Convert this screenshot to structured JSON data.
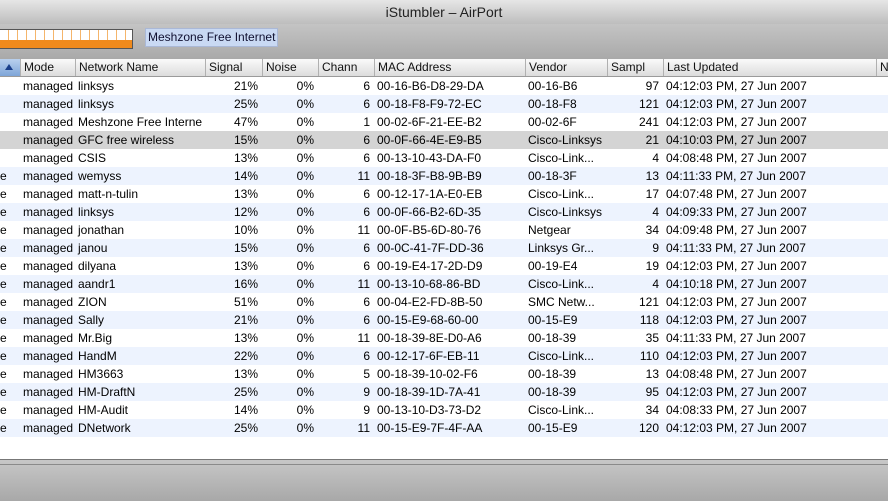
{
  "window": {
    "title": "iStumbler – AirPort"
  },
  "toolbar": {
    "network_label": "Meshzone Free Internet"
  },
  "table": {
    "columns": [
      "",
      "Mode",
      "Network Name",
      "Signal",
      "Noise",
      "Chann",
      "MAC Address",
      "Vendor",
      "Sampl",
      "Last Updated",
      "N"
    ],
    "rows": [
      {
        "lead": "",
        "mode": "managed",
        "name": "linksys",
        "signal": "21%",
        "noise": "0%",
        "channel": "6",
        "mac": "00-16-B6-D8-29-DA",
        "vendor": "00-16-B6",
        "samples": "97",
        "updated": "04:12:03 PM, 27 Jun 2007"
      },
      {
        "lead": "",
        "mode": "managed",
        "name": "linksys",
        "signal": "25%",
        "noise": "0%",
        "channel": "6",
        "mac": "00-18-F8-F9-72-EC",
        "vendor": "00-18-F8",
        "samples": "121",
        "updated": "04:12:03 PM, 27 Jun 2007"
      },
      {
        "lead": "",
        "mode": "managed",
        "name": "Meshzone Free Interne",
        "signal": "47%",
        "noise": "0%",
        "channel": "1",
        "mac": "00-02-6F-21-EE-B2",
        "vendor": "00-02-6F",
        "samples": "241",
        "updated": "04:12:03 PM, 27 Jun 2007"
      },
      {
        "lead": "",
        "mode": "managed",
        "name": "GFC free wireless",
        "signal": "15%",
        "noise": "0%",
        "channel": "6",
        "mac": "00-0F-66-4E-E9-B5",
        "vendor": "Cisco-Linksys",
        "samples": "21",
        "updated": "04:10:03 PM, 27 Jun 2007"
      },
      {
        "lead": "",
        "mode": "managed",
        "name": "CSIS",
        "signal": "13%",
        "noise": "0%",
        "channel": "6",
        "mac": "00-13-10-43-DA-F0",
        "vendor": "Cisco-Link...",
        "samples": "4",
        "updated": "04:08:48 PM, 27 Jun 2007"
      },
      {
        "lead": "e",
        "mode": "managed",
        "name": "wemyss",
        "signal": "14%",
        "noise": "0%",
        "channel": "11",
        "mac": "00-18-3F-B8-9B-B9",
        "vendor": "00-18-3F",
        "samples": "13",
        "updated": "04:11:33 PM, 27 Jun 2007"
      },
      {
        "lead": "e",
        "mode": "managed",
        "name": "matt-n-tulin",
        "signal": "13%",
        "noise": "0%",
        "channel": "6",
        "mac": "00-12-17-1A-E0-EB",
        "vendor": "Cisco-Link...",
        "samples": "17",
        "updated": "04:07:48 PM, 27 Jun 2007"
      },
      {
        "lead": "e",
        "mode": "managed",
        "name": "linksys",
        "signal": "12%",
        "noise": "0%",
        "channel": "6",
        "mac": "00-0F-66-B2-6D-35",
        "vendor": "Cisco-Linksys",
        "samples": "4",
        "updated": "04:09:33 PM, 27 Jun 2007"
      },
      {
        "lead": "e",
        "mode": "managed",
        "name": "jonathan",
        "signal": "10%",
        "noise": "0%",
        "channel": "11",
        "mac": "00-0F-B5-6D-80-76",
        "vendor": "Netgear",
        "samples": "34",
        "updated": "04:09:48 PM, 27 Jun 2007"
      },
      {
        "lead": "e",
        "mode": "managed",
        "name": "janou",
        "signal": "15%",
        "noise": "0%",
        "channel": "6",
        "mac": "00-0C-41-7F-DD-36",
        "vendor": "Linksys Gr...",
        "samples": "9",
        "updated": "04:11:33 PM, 27 Jun 2007"
      },
      {
        "lead": "e",
        "mode": "managed",
        "name": "dilyana",
        "signal": "13%",
        "noise": "0%",
        "channel": "6",
        "mac": "00-19-E4-17-2D-D9",
        "vendor": "00-19-E4",
        "samples": "19",
        "updated": "04:12:03 PM, 27 Jun 2007"
      },
      {
        "lead": "e",
        "mode": "managed",
        "name": "aandr1",
        "signal": "16%",
        "noise": "0%",
        "channel": "11",
        "mac": "00-13-10-68-86-BD",
        "vendor": "Cisco-Link...",
        "samples": "4",
        "updated": "04:10:18 PM, 27 Jun 2007"
      },
      {
        "lead": "e",
        "mode": "managed",
        "name": "ZION",
        "signal": "51%",
        "noise": "0%",
        "channel": "6",
        "mac": "00-04-E2-FD-8B-50",
        "vendor": "SMC Netw...",
        "samples": "121",
        "updated": "04:12:03 PM, 27 Jun 2007"
      },
      {
        "lead": "e",
        "mode": "managed",
        "name": "Sally",
        "signal": "21%",
        "noise": "0%",
        "channel": "6",
        "mac": "00-15-E9-68-60-00",
        "vendor": "00-15-E9",
        "samples": "118",
        "updated": "04:12:03 PM, 27 Jun 2007"
      },
      {
        "lead": "e",
        "mode": "managed",
        "name": "Mr.Big",
        "signal": "13%",
        "noise": "0%",
        "channel": "11",
        "mac": "00-18-39-8E-D0-A6",
        "vendor": "00-18-39",
        "samples": "35",
        "updated": "04:11:33 PM, 27 Jun 2007"
      },
      {
        "lead": "e",
        "mode": "managed",
        "name": "HandM",
        "signal": "22%",
        "noise": "0%",
        "channel": "6",
        "mac": "00-12-17-6F-EB-11",
        "vendor": "Cisco-Link...",
        "samples": "110",
        "updated": "04:12:03 PM, 27 Jun 2007"
      },
      {
        "lead": "e",
        "mode": "managed",
        "name": "HM3663",
        "signal": "13%",
        "noise": "0%",
        "channel": "5",
        "mac": "00-18-39-10-02-F6",
        "vendor": "00-18-39",
        "samples": "13",
        "updated": "04:08:48 PM, 27 Jun 2007"
      },
      {
        "lead": "e",
        "mode": "managed",
        "name": "HM-DraftN",
        "signal": "25%",
        "noise": "0%",
        "channel": "9",
        "mac": "00-18-39-1D-7A-41",
        "vendor": "00-18-39",
        "samples": "95",
        "updated": "04:12:03 PM, 27 Jun 2007"
      },
      {
        "lead": "e",
        "mode": "managed",
        "name": "HM-Audit",
        "signal": "14%",
        "noise": "0%",
        "channel": "9",
        "mac": "00-13-10-D3-73-D2",
        "vendor": "Cisco-Link...",
        "samples": "34",
        "updated": "04:08:33 PM, 27 Jun 2007"
      },
      {
        "lead": "e",
        "mode": "managed",
        "name": "DNetwork",
        "signal": "25%",
        "noise": "0%",
        "channel": "11",
        "mac": "00-15-E9-7F-4F-AA",
        "vendor": "00-15-E9",
        "samples": "120",
        "updated": "04:12:03 PM, 27 Jun 2007"
      }
    ]
  }
}
